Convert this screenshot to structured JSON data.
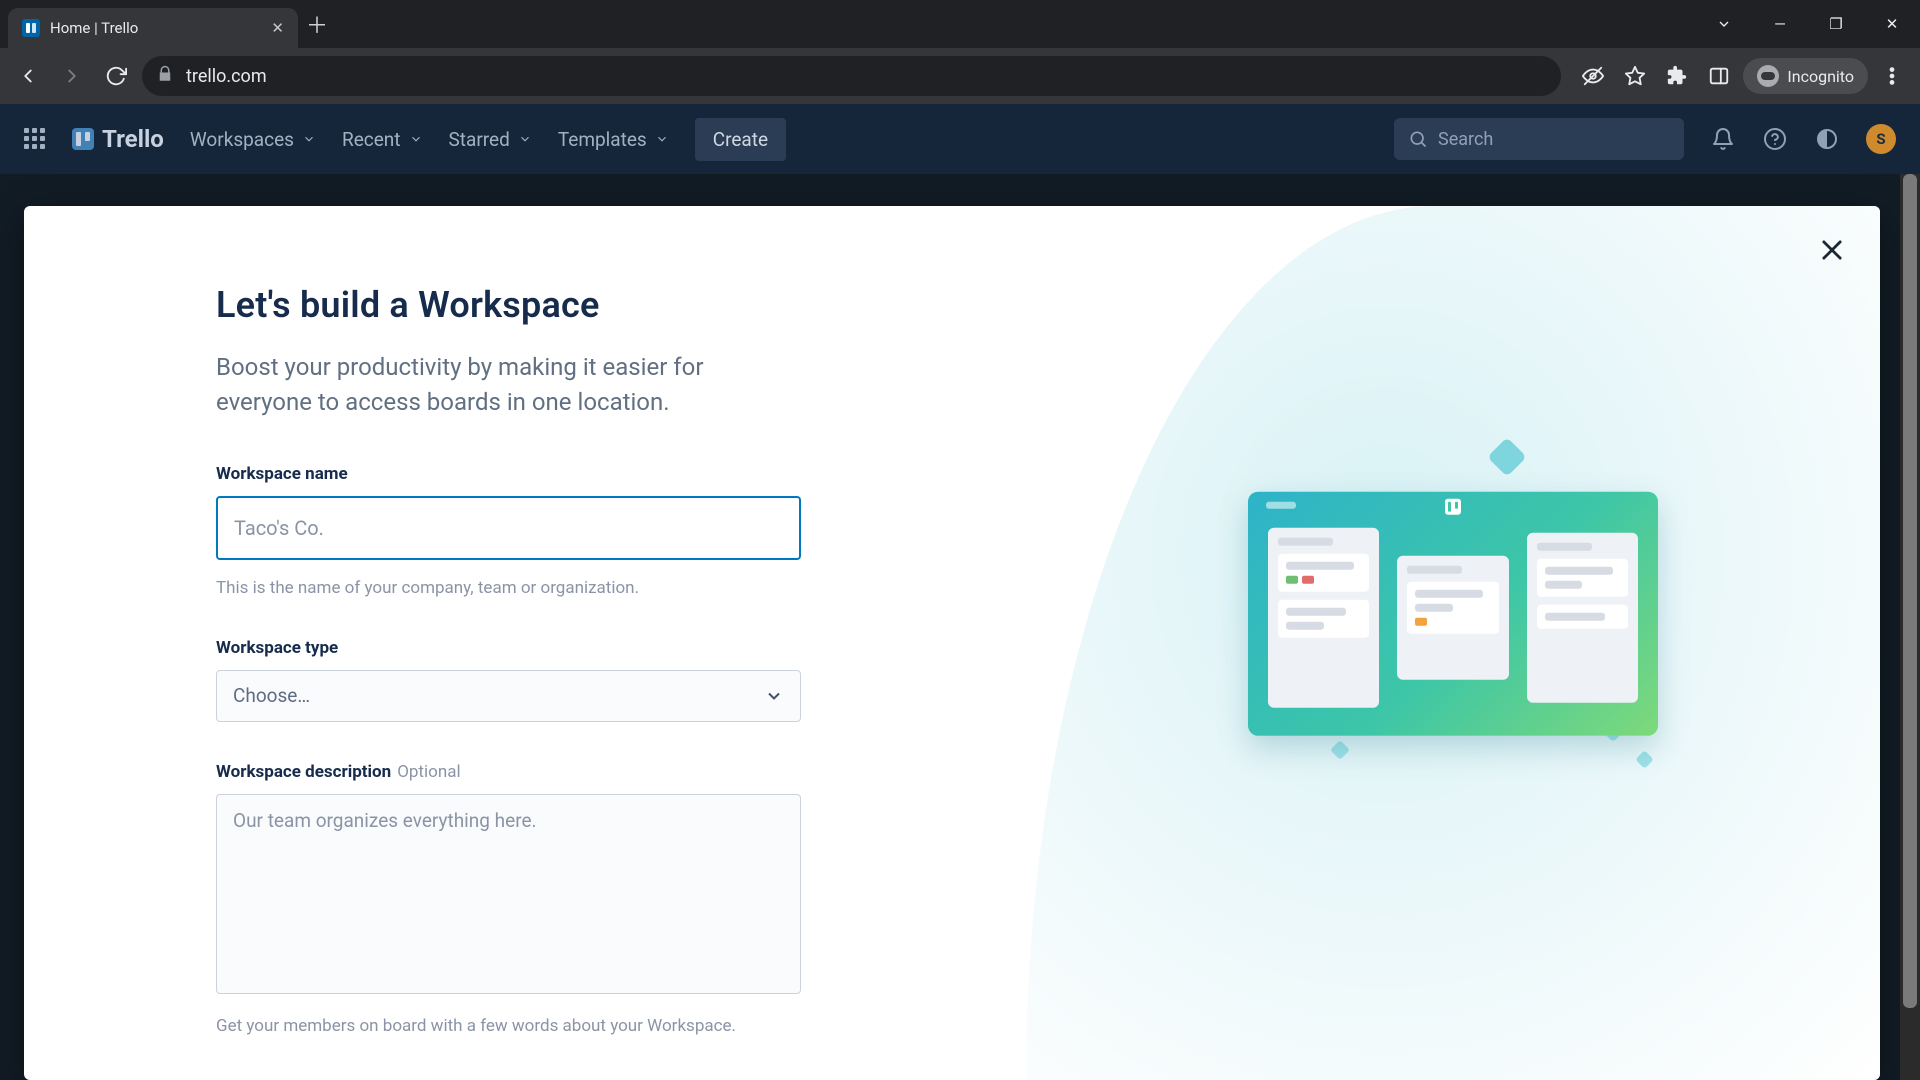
{
  "browser": {
    "tab_title": "Home | Trello",
    "url": "trello.com",
    "incognito_label": "Incognito"
  },
  "header": {
    "logo_text": "Trello",
    "menu": {
      "workspaces": "Workspaces",
      "recent": "Recent",
      "starred": "Starred",
      "templates": "Templates"
    },
    "create": "Create",
    "search_placeholder": "Search",
    "avatar_initial": "S"
  },
  "modal": {
    "title": "Let's build a Workspace",
    "subtitle": "Boost your productivity by making it easier for everyone to access boards in one location.",
    "name": {
      "label": "Workspace name",
      "placeholder": "Taco's Co.",
      "value": "",
      "helper": "This is the name of your company, team or organization."
    },
    "type": {
      "label": "Workspace type",
      "selected": "Choose…"
    },
    "description": {
      "label": "Workspace description",
      "optional": "Optional",
      "placeholder": "Our team organizes everything here.",
      "value": "",
      "helper": "Get your members on board with a few words about your Workspace."
    }
  }
}
